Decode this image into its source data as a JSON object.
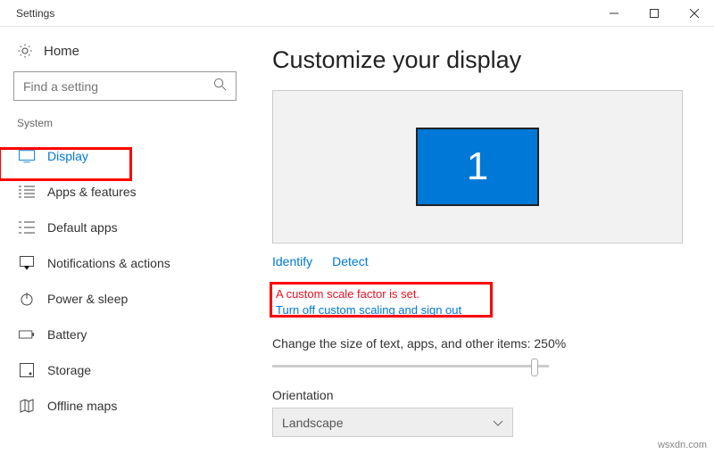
{
  "window": {
    "title": "Settings"
  },
  "sidebar": {
    "home": "Home",
    "search_placeholder": "Find a setting",
    "section": "System",
    "items": [
      {
        "label": "Display"
      },
      {
        "label": "Apps & features"
      },
      {
        "label": "Default apps"
      },
      {
        "label": "Notifications & actions"
      },
      {
        "label": "Power & sleep"
      },
      {
        "label": "Battery"
      },
      {
        "label": "Storage"
      },
      {
        "label": "Offline maps"
      }
    ]
  },
  "main": {
    "title": "Customize your display",
    "monitor_number": "1",
    "identify": "Identify",
    "detect": "Detect",
    "warning": "A custom scale factor is set.",
    "turn_off_link": "Turn off custom scaling and sign out",
    "scale_label": "Change the size of text, apps, and other items: 250%",
    "orientation_label": "Orientation",
    "orientation_value": "Landscape"
  },
  "watermark": "wsxdn.com"
}
